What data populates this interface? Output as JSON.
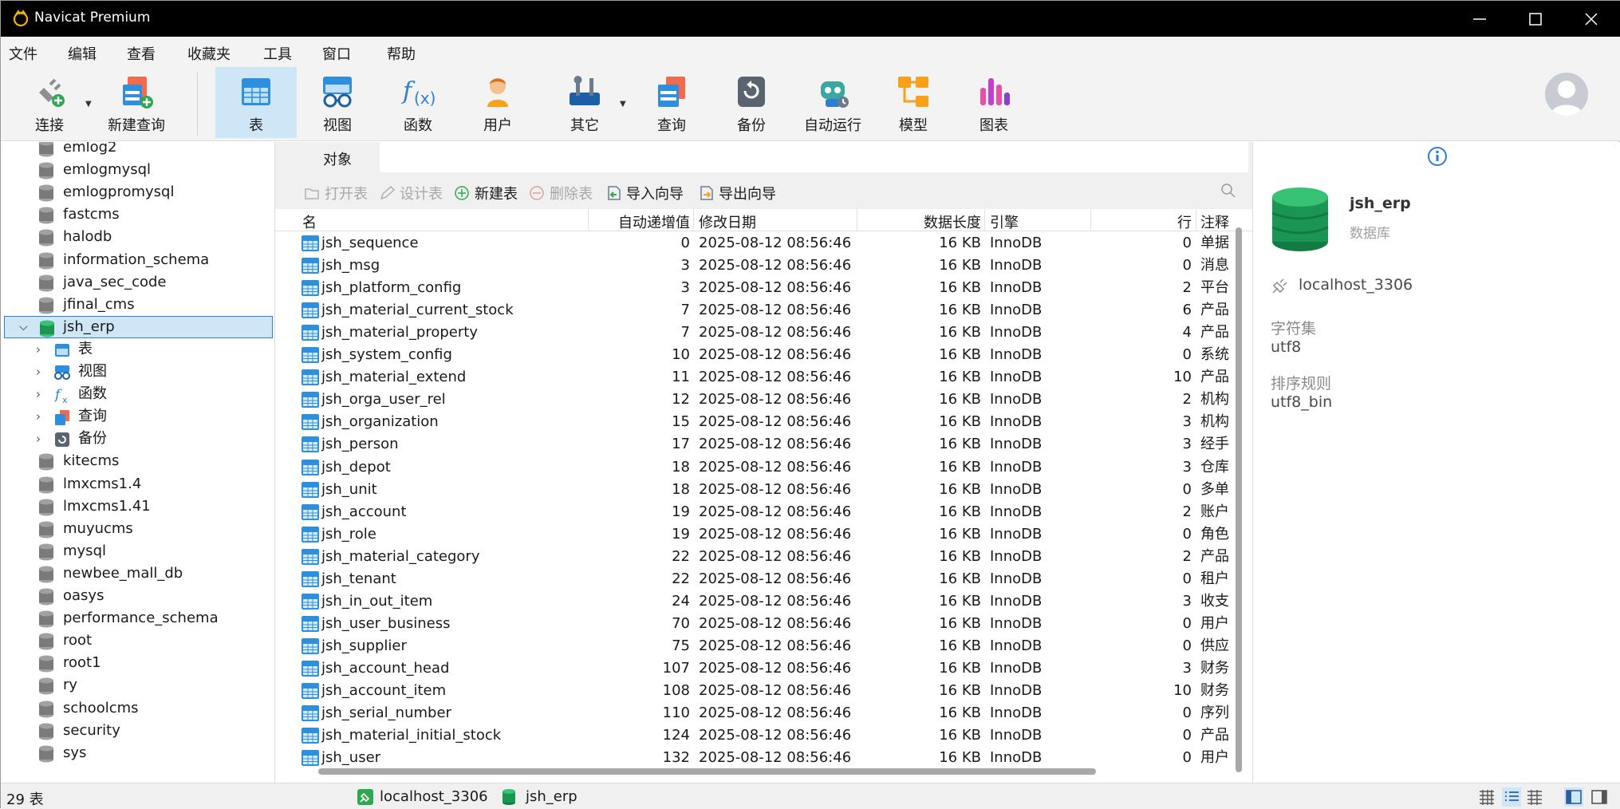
{
  "app": {
    "title": "Navicat Premium"
  },
  "menu": [
    "文件",
    "编辑",
    "查看",
    "收藏夹",
    "工具",
    "窗口",
    "帮助"
  ],
  "toolbar": {
    "connect": "连接",
    "new_query": "新建查询",
    "table": "表",
    "view": "视图",
    "function": "函数",
    "user": "用户",
    "other": "其它",
    "query": "查询",
    "backup": "备份",
    "auto_run": "自动运行",
    "model": "模型",
    "chart": "图表"
  },
  "tree": {
    "databases": [
      "emlog2",
      "emlogmysql",
      "emlogpromysql",
      "fastcms",
      "halodb",
      "information_schema",
      "java_sec_code",
      "jfinal_cms"
    ],
    "selected": "jsh_erp",
    "children": [
      "表",
      "视图",
      "函数",
      "查询",
      "备份"
    ],
    "databases_after": [
      "kitecms",
      "lmxcms1.4",
      "lmxcms1.41",
      "muyucms",
      "mysql",
      "newbee_mall_db",
      "oasys",
      "performance_schema",
      "root",
      "root1",
      "ry",
      "schoolcms",
      "security",
      "sys"
    ]
  },
  "objects_tab": "对象",
  "actions": {
    "open_table": "打开表",
    "design_table": "设计表",
    "new_table": "新建表",
    "delete_table": "删除表",
    "import_wizard": "导入向导",
    "export_wizard": "导出向导"
  },
  "columns": {
    "name": "名",
    "auto_inc": "自动递增值",
    "modified": "修改日期",
    "data_length": "数据长度",
    "engine": "引擎",
    "rows": "行",
    "comment": "注释"
  },
  "table_rows": [
    {
      "name": "jsh_sequence",
      "auto_inc": "0",
      "modified": "2025-08-12 08:56:46",
      "size": "16 KB",
      "engine": "InnoDB",
      "rows": "0",
      "comment": "单据"
    },
    {
      "name": "jsh_msg",
      "auto_inc": "3",
      "modified": "2025-08-12 08:56:46",
      "size": "16 KB",
      "engine": "InnoDB",
      "rows": "0",
      "comment": "消息"
    },
    {
      "name": "jsh_platform_config",
      "auto_inc": "3",
      "modified": "2025-08-12 08:56:46",
      "size": "16 KB",
      "engine": "InnoDB",
      "rows": "2",
      "comment": "平台"
    },
    {
      "name": "jsh_material_current_stock",
      "auto_inc": "7",
      "modified": "2025-08-12 08:56:46",
      "size": "16 KB",
      "engine": "InnoDB",
      "rows": "6",
      "comment": "产品"
    },
    {
      "name": "jsh_material_property",
      "auto_inc": "7",
      "modified": "2025-08-12 08:56:46",
      "size": "16 KB",
      "engine": "InnoDB",
      "rows": "4",
      "comment": "产品"
    },
    {
      "name": "jsh_system_config",
      "auto_inc": "10",
      "modified": "2025-08-12 08:56:46",
      "size": "16 KB",
      "engine": "InnoDB",
      "rows": "0",
      "comment": "系统"
    },
    {
      "name": "jsh_material_extend",
      "auto_inc": "11",
      "modified": "2025-08-12 08:56:46",
      "size": "16 KB",
      "engine": "InnoDB",
      "rows": "10",
      "comment": "产品"
    },
    {
      "name": "jsh_orga_user_rel",
      "auto_inc": "12",
      "modified": "2025-08-12 08:56:46",
      "size": "16 KB",
      "engine": "InnoDB",
      "rows": "2",
      "comment": "机构"
    },
    {
      "name": "jsh_organization",
      "auto_inc": "15",
      "modified": "2025-08-12 08:56:46",
      "size": "16 KB",
      "engine": "InnoDB",
      "rows": "3",
      "comment": "机构"
    },
    {
      "name": "jsh_person",
      "auto_inc": "17",
      "modified": "2025-08-12 08:56:46",
      "size": "16 KB",
      "engine": "InnoDB",
      "rows": "3",
      "comment": "经手"
    },
    {
      "name": "jsh_depot",
      "auto_inc": "18",
      "modified": "2025-08-12 08:56:46",
      "size": "16 KB",
      "engine": "InnoDB",
      "rows": "3",
      "comment": "仓库"
    },
    {
      "name": "jsh_unit",
      "auto_inc": "18",
      "modified": "2025-08-12 08:56:46",
      "size": "16 KB",
      "engine": "InnoDB",
      "rows": "0",
      "comment": "多单"
    },
    {
      "name": "jsh_account",
      "auto_inc": "19",
      "modified": "2025-08-12 08:56:46",
      "size": "16 KB",
      "engine": "InnoDB",
      "rows": "2",
      "comment": "账户"
    },
    {
      "name": "jsh_role",
      "auto_inc": "19",
      "modified": "2025-08-12 08:56:46",
      "size": "16 KB",
      "engine": "InnoDB",
      "rows": "0",
      "comment": "角色"
    },
    {
      "name": "jsh_material_category",
      "auto_inc": "22",
      "modified": "2025-08-12 08:56:46",
      "size": "16 KB",
      "engine": "InnoDB",
      "rows": "2",
      "comment": "产品"
    },
    {
      "name": "jsh_tenant",
      "auto_inc": "22",
      "modified": "2025-08-12 08:56:46",
      "size": "16 KB",
      "engine": "InnoDB",
      "rows": "0",
      "comment": "租户"
    },
    {
      "name": "jsh_in_out_item",
      "auto_inc": "24",
      "modified": "2025-08-12 08:56:46",
      "size": "16 KB",
      "engine": "InnoDB",
      "rows": "3",
      "comment": "收支"
    },
    {
      "name": "jsh_user_business",
      "auto_inc": "70",
      "modified": "2025-08-12 08:56:46",
      "size": "16 KB",
      "engine": "InnoDB",
      "rows": "0",
      "comment": "用户"
    },
    {
      "name": "jsh_supplier",
      "auto_inc": "75",
      "modified": "2025-08-12 08:56:46",
      "size": "16 KB",
      "engine": "InnoDB",
      "rows": "0",
      "comment": "供应"
    },
    {
      "name": "jsh_account_head",
      "auto_inc": "107",
      "modified": "2025-08-12 08:56:46",
      "size": "16 KB",
      "engine": "InnoDB",
      "rows": "3",
      "comment": "财务"
    },
    {
      "name": "jsh_account_item",
      "auto_inc": "108",
      "modified": "2025-08-12 08:56:46",
      "size": "16 KB",
      "engine": "InnoDB",
      "rows": "10",
      "comment": "财务"
    },
    {
      "name": "jsh_serial_number",
      "auto_inc": "110",
      "modified": "2025-08-12 08:56:46",
      "size": "16 KB",
      "engine": "InnoDB",
      "rows": "0",
      "comment": "序列"
    },
    {
      "name": "jsh_material_initial_stock",
      "auto_inc": "124",
      "modified": "2025-08-12 08:56:46",
      "size": "16 KB",
      "engine": "InnoDB",
      "rows": "0",
      "comment": "产品"
    },
    {
      "name": "jsh_user",
      "auto_inc": "132",
      "modified": "2025-08-12 08:56:46",
      "size": "16 KB",
      "engine": "InnoDB",
      "rows": "0",
      "comment": "用户"
    }
  ],
  "info": {
    "name": "jsh_erp",
    "type": "数据库",
    "connection": "localhost_3306",
    "charset_label": "字符集",
    "charset": "utf8",
    "collation_label": "排序规则",
    "collation": "utf8_bin"
  },
  "status": {
    "count": "29 表",
    "connection": "localhost_3306",
    "database": "jsh_erp"
  },
  "colors": {
    "accent": "#2d7dd2",
    "selection": "#cfe6f7",
    "title_bar": "#000000",
    "db_selected": "#1fa05a"
  }
}
